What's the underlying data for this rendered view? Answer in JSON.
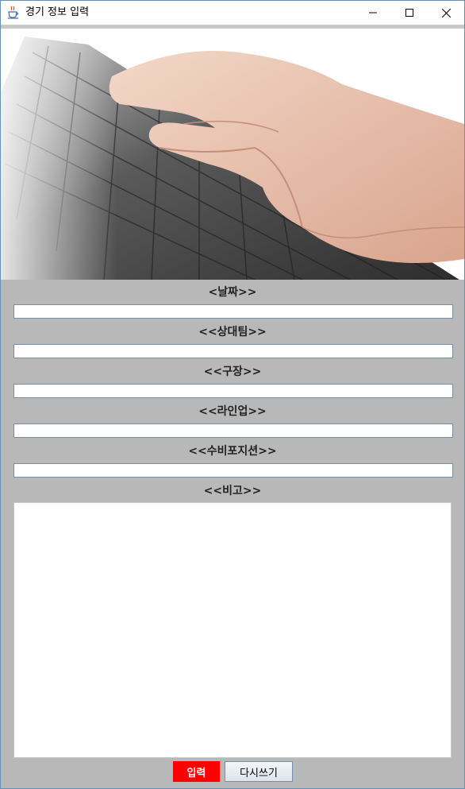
{
  "window": {
    "title": "경기 정보 입력"
  },
  "form": {
    "date_label": "<날짜>>",
    "opponent_label": "<<상대팀>>",
    "stadium_label": "<<구장>>",
    "lineup_label": "<<라인업>>",
    "position_label": "<<수비포지션>>",
    "notes_label": "<<비고>>",
    "date_value": "",
    "opponent_value": "",
    "stadium_value": "",
    "lineup_value": "",
    "position_value": "",
    "notes_value": ""
  },
  "buttons": {
    "submit_label": "입력",
    "reset_label": "다시쓰기"
  },
  "colors": {
    "background": "#b8b8b8",
    "submit_button": "#ff0000",
    "submit_text": "#ffffff"
  },
  "icons": {
    "app": "java-cup-icon",
    "minimize": "minimize-icon",
    "maximize": "maximize-icon",
    "close": "close-icon"
  }
}
